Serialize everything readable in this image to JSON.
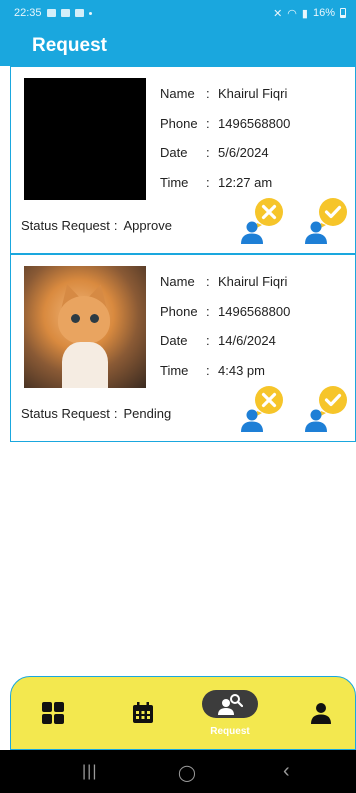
{
  "status_bar": {
    "time": "22:35",
    "battery": "16%"
  },
  "app_bar": {
    "title": "Request"
  },
  "labels": {
    "name": "Name",
    "phone": "Phone",
    "date": "Date",
    "time": "Time",
    "status": "Status Request",
    "colon": ":"
  },
  "requests": [
    {
      "name": "Khairul Fiqri",
      "phone": "1496568800",
      "date": "5/6/2024",
      "time": "12:27 am",
      "status": "Approve"
    },
    {
      "name": "Khairul Fiqri",
      "phone": "1496568800",
      "date": "14/6/2024",
      "time": "4:43 pm",
      "status": "Pending"
    }
  ],
  "colors": {
    "primary": "#1aa7de",
    "nav_bg": "#f3e84f",
    "action_yellow": "#f6c52a",
    "person_blue": "#1e7fd6"
  },
  "bottom_nav": {
    "items": [
      {
        "icon": "dashboard-icon"
      },
      {
        "icon": "calendar-icon"
      },
      {
        "icon": "request-icon",
        "label": "Request",
        "active": true
      },
      {
        "icon": "profile-icon"
      }
    ]
  },
  "system_nav": {
    "recent": "|||",
    "home": "◯",
    "back": "‹"
  }
}
